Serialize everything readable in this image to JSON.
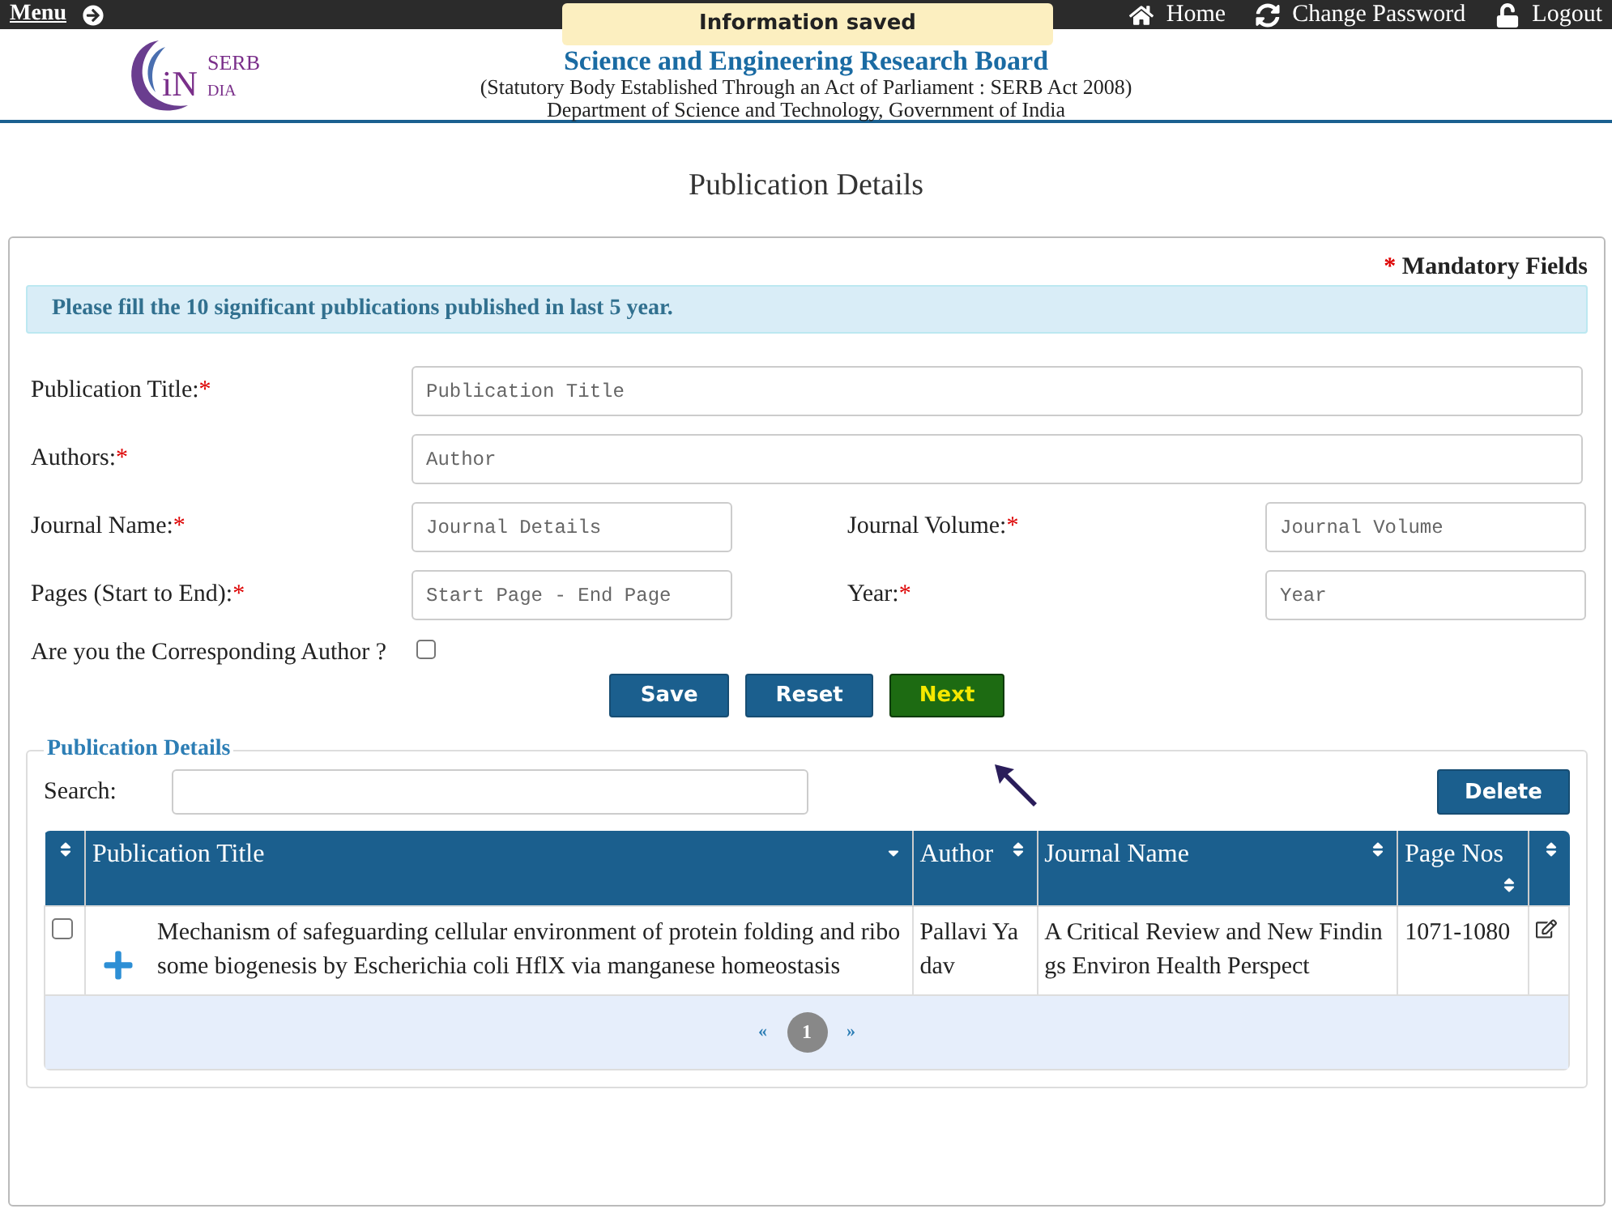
{
  "top_bar": {
    "menu": "Menu",
    "links": [
      {
        "kind": "home",
        "label": "Home"
      },
      {
        "kind": "password",
        "label": "Change Password"
      },
      {
        "kind": "logout",
        "label": "Logout"
      }
    ]
  },
  "toast": "Information saved",
  "header": {
    "logo_mark": "iN",
    "logo_text": "SERB",
    "logo_sub": "DIA",
    "title": "Science and Engineering Research Board",
    "subtitle": "(Statutory Body Established Through an Act of Parliament : SERB Act 2008)",
    "department": "Department of Science and Technology, Government of India"
  },
  "page_title": "Publication Details",
  "mandatory_note": {
    "star": "*",
    "label": "Mandatory Fields"
  },
  "info_message": "Please fill the 10 significant publications published in last 5 year.",
  "form_rows": [
    {
      "fields": [
        {
          "label": "Publication Title:",
          "required": true,
          "placeholder": "Publication Title"
        }
      ]
    },
    {
      "fields": [
        {
          "label": "Authors:",
          "required": true,
          "placeholder": "Author"
        }
      ]
    },
    {
      "fields": [
        {
          "label": "Journal Name:",
          "required": true,
          "placeholder": "Journal Details"
        },
        {
          "label": "Journal Volume:",
          "required": true,
          "placeholder": "Journal Volume"
        }
      ]
    },
    {
      "fields": [
        {
          "label": "Pages (Start to End):",
          "required": true,
          "placeholder": "Start Page - End Page"
        },
        {
          "label": "Year:",
          "required": true,
          "placeholder": "Year"
        }
      ]
    }
  ],
  "corresponding_author": {
    "label": "Are you the Corresponding Author ?",
    "checked": false
  },
  "buttons": [
    {
      "label": "Save",
      "kind": "primary"
    },
    {
      "label": "Reset",
      "kind": "primary"
    },
    {
      "label": "Next",
      "kind": "next"
    }
  ],
  "table_section": {
    "legend": "Publication Details",
    "search_label": "Search:",
    "delete_button": "Delete",
    "columns": [
      {
        "label": "Publication Title",
        "sorted": true
      },
      {
        "label": "Author",
        "sorted": false
      },
      {
        "label": "Journal Name",
        "sorted": false
      },
      {
        "label": "Page Nos",
        "sorted": false
      }
    ],
    "rows": [
      {
        "checked": false,
        "title": "Mechanism of safeguarding cellular environment of protein folding and ribosome biogenesis by Escherichia coli HflX via manganese homeostasis",
        "author": "Pallavi Yadav",
        "journal": "A Critical Review and New Findings Environ Health Perspect",
        "pages": "1071-1080"
      }
    ],
    "pagination": {
      "prev": "«",
      "pages": [
        {
          "label": "1",
          "selected": true
        }
      ],
      "next": "»"
    }
  }
}
